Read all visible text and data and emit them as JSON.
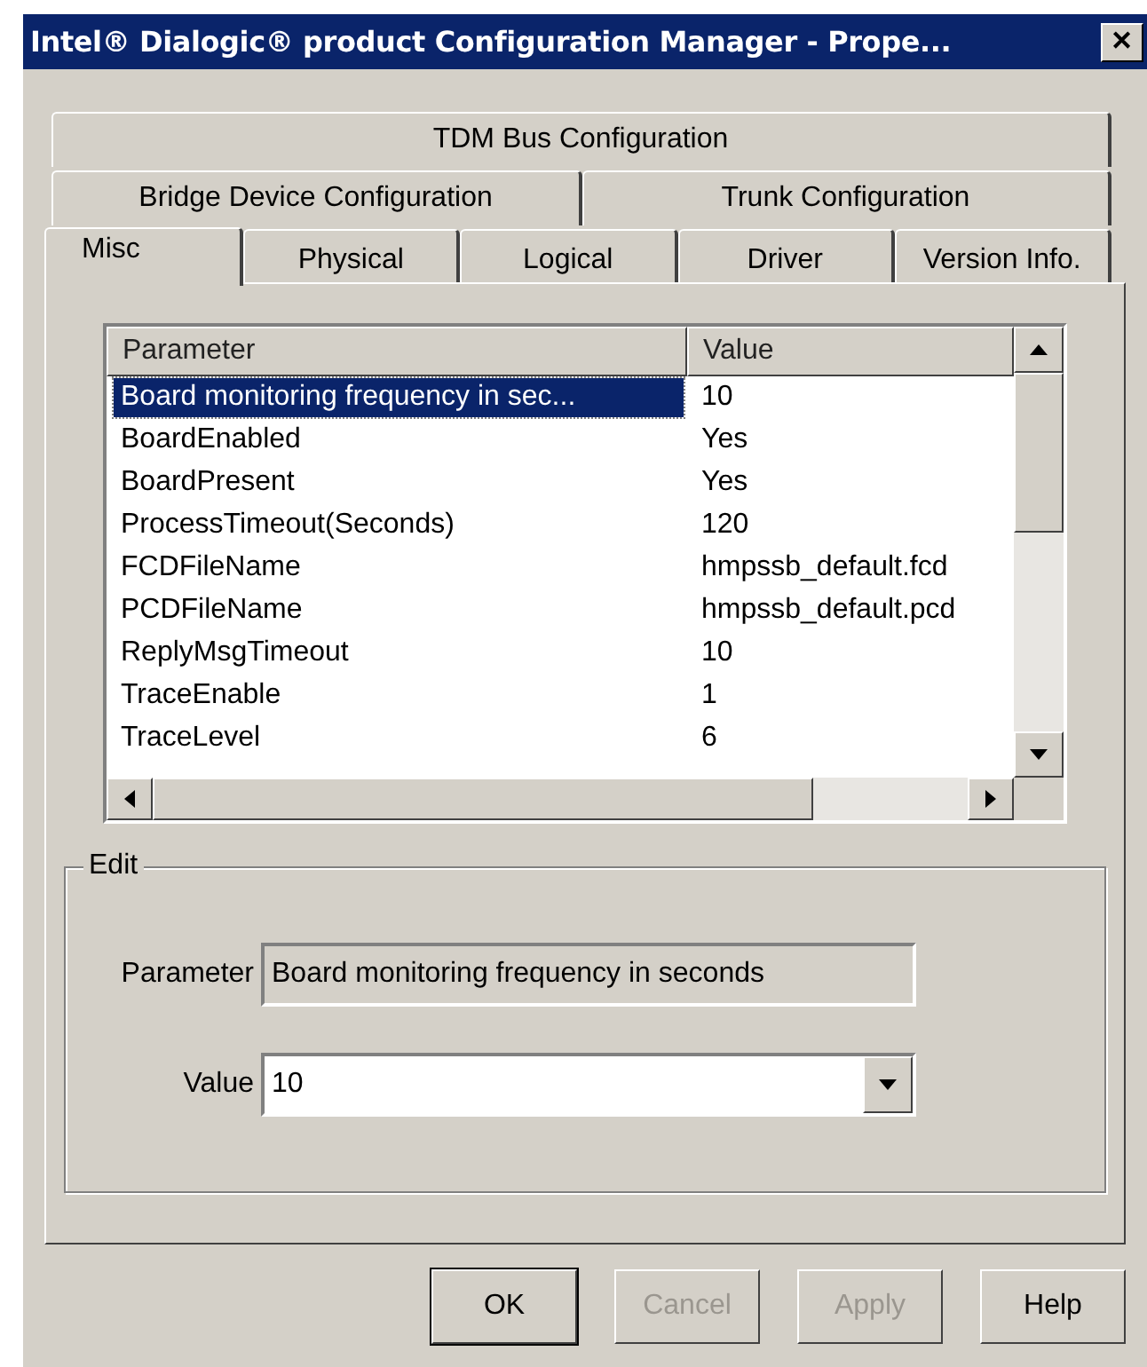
{
  "window": {
    "title": "Intel® Dialogic® product Configuration Manager - Prope...",
    "close": "✕"
  },
  "tab_rows": [
    [
      {
        "label": "TDM Bus Configuration",
        "selected": false
      }
    ],
    [
      {
        "label": "Bridge Device Configuration",
        "selected": false
      },
      {
        "label": "Trunk Configuration",
        "selected": false
      }
    ],
    [
      {
        "label": "Misc",
        "selected": true
      },
      {
        "label": "Physical",
        "selected": false
      },
      {
        "label": "Logical",
        "selected": false
      },
      {
        "label": "Driver",
        "selected": false
      },
      {
        "label": "Version Info.",
        "selected": false
      }
    ]
  ],
  "table": {
    "columns": [
      "Parameter",
      "Value"
    ],
    "rows": [
      {
        "parameter": "Board monitoring frequency in sec...",
        "value": "10",
        "selected": true
      },
      {
        "parameter": "BoardEnabled",
        "value": "Yes",
        "selected": false
      },
      {
        "parameter": "BoardPresent",
        "value": "Yes",
        "selected": false
      },
      {
        "parameter": "ProcessTimeout(Seconds)",
        "value": "120",
        "selected": false
      },
      {
        "parameter": "FCDFileName",
        "value": "hmpssb_default.fcd",
        "selected": false
      },
      {
        "parameter": "PCDFileName",
        "value": "hmpssb_default.pcd",
        "selected": false
      },
      {
        "parameter": "ReplyMsgTimeout",
        "value": "10",
        "selected": false
      },
      {
        "parameter": "TraceEnable",
        "value": "1",
        "selected": false
      },
      {
        "parameter": "TraceLevel",
        "value": "6",
        "selected": false
      }
    ]
  },
  "edit": {
    "title": "Edit",
    "parameter_label": "Parameter",
    "parameter_value": "Board monitoring frequency in seconds",
    "value_label": "Value",
    "value": "10"
  },
  "buttons": [
    {
      "label": "OK",
      "disabled": false,
      "default": true
    },
    {
      "label": "Cancel",
      "disabled": true,
      "default": false
    },
    {
      "label": "Apply",
      "disabled": true,
      "default": false
    },
    {
      "label": "Help",
      "disabled": false,
      "default": false
    }
  ]
}
